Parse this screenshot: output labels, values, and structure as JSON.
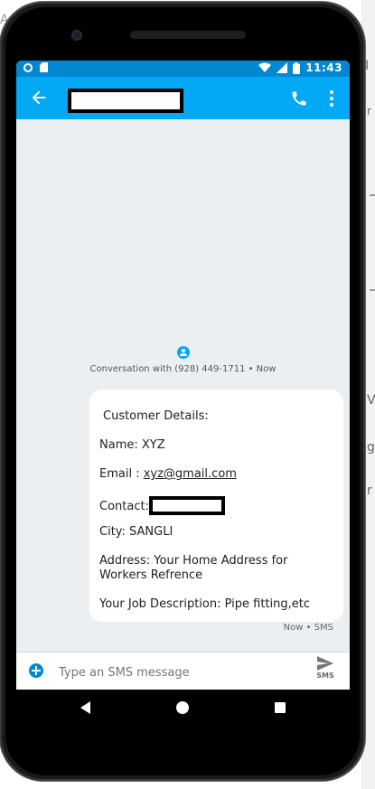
{
  "status_bar": {
    "time": "11:43"
  },
  "app_bar": {
    "contact_name_redacted": ""
  },
  "conversation": {
    "header": "Conversation with (928) 449-1711 • Now",
    "message": {
      "lines": [
        "Customer Details:",
        "Name: XYZ",
        "Email : ",
        "Contact:",
        "City: SANGLI",
        "Address: Your Home Address for Workers Refrence",
        "Your Job Description: Pipe fitting,etc"
      ],
      "email_value": "xyz@gmail.com"
    },
    "message_meta": "Now • SMS"
  },
  "compose": {
    "placeholder": "Type an SMS message",
    "send_label": "SMS"
  },
  "colors": {
    "status_bar": "#0288d1",
    "app_bar": "#03a9f4",
    "screen_bg": "#eceff1"
  },
  "icons": {
    "back": "arrow-left-icon",
    "call": "phone-icon",
    "more": "more-vert-icon",
    "add": "add-circle-icon",
    "send": "send-icon"
  }
}
